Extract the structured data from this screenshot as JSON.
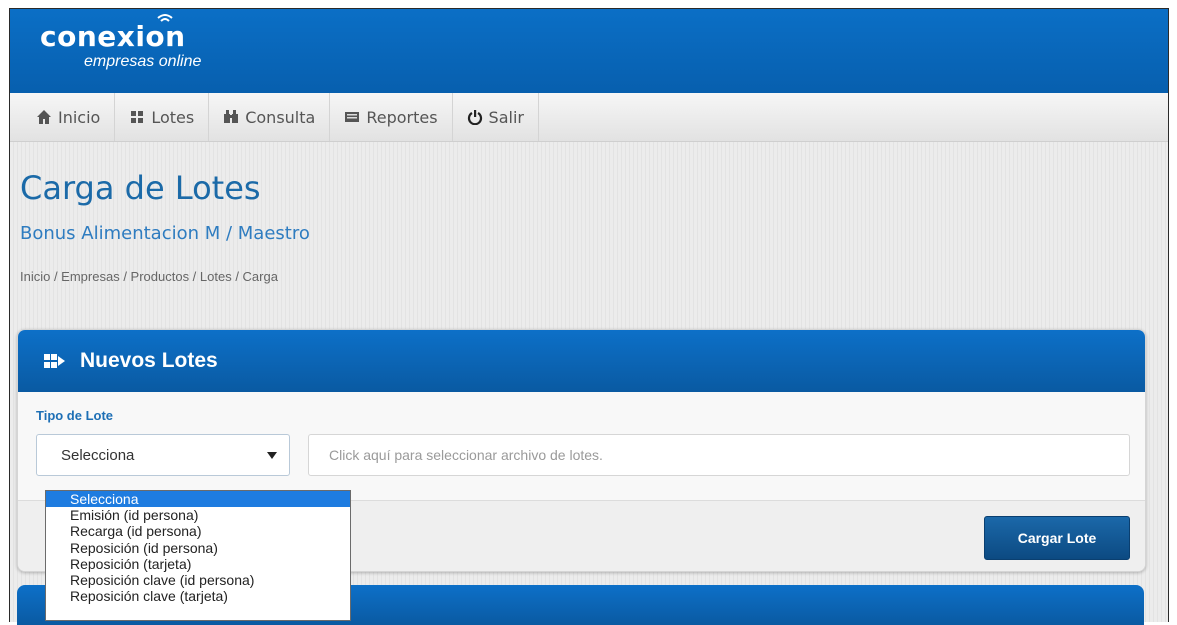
{
  "brand": {
    "name": "conexion",
    "tagline": "empresas online"
  },
  "nav": {
    "items": [
      {
        "label": "Inicio",
        "icon": "home-icon"
      },
      {
        "label": "Lotes",
        "icon": "lotes-icon"
      },
      {
        "label": "Consulta",
        "icon": "binoculars-icon"
      },
      {
        "label": "Reportes",
        "icon": "report-icon"
      },
      {
        "label": "Salir",
        "icon": "power-icon"
      }
    ]
  },
  "page": {
    "title": "Carga de Lotes",
    "subtitle": "Bonus Alimentacion M / Maestro",
    "breadcrumb": "Inicio / Empresas / Productos / Lotes / Carga"
  },
  "panel": {
    "title": "Nuevos Lotes",
    "icon": "batch-icon",
    "field_label": "Tipo de Lote",
    "select_value": "Selecciona",
    "file_placeholder": "Click aquí para seleccionar archivo de lotes.",
    "submit_label": "Cargar Lote"
  },
  "dropdown": {
    "selected_index": 0,
    "options": [
      "Selecciona",
      "Emisión (id persona)",
      "Recarga (id persona)",
      "Reposición (id persona)",
      "Reposición (tarjeta)",
      "Reposición clave (id persona)",
      "Reposición clave (tarjeta)"
    ]
  },
  "colors": {
    "header_blue": "#0b6fc6",
    "title_blue": "#1b6aa8",
    "button_blue": "#1b68a9",
    "selected_option": "#1e7ce0"
  }
}
